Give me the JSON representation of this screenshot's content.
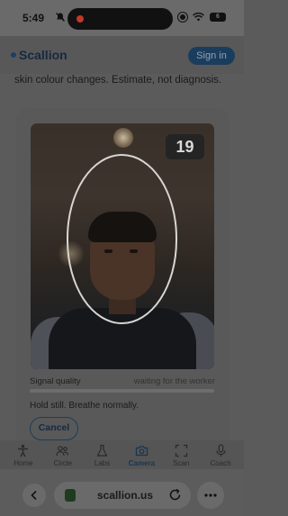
{
  "status_bar": {
    "time": "5:49",
    "battery": "6"
  },
  "header": {
    "brand": "Scallion",
    "signin_label": "Sign in"
  },
  "intro": {
    "line1": "skin colour changes. Estimate, not diagnosis."
  },
  "scan": {
    "countdown": "19",
    "signal_label": "Signal quality",
    "signal_status": "waiting for the worker",
    "signal_level": 0,
    "hint": "Hold still. Breathe normally.",
    "cancel_label": "Cancel"
  },
  "nav": {
    "items": [
      {
        "label": "Home",
        "icon": "person-icon"
      },
      {
        "label": "Circle",
        "icon": "people-icon"
      },
      {
        "label": "Labs",
        "icon": "flask-icon"
      },
      {
        "label": "Camera",
        "icon": "camera-icon",
        "active": true
      },
      {
        "label": "Scan",
        "icon": "scan-frame-icon"
      },
      {
        "label": "Coach",
        "icon": "microphone-icon"
      }
    ]
  },
  "browser": {
    "url": "scallion.us"
  },
  "colors": {
    "accent": "#1b3d5d",
    "overlay": "#5b5b5b"
  }
}
